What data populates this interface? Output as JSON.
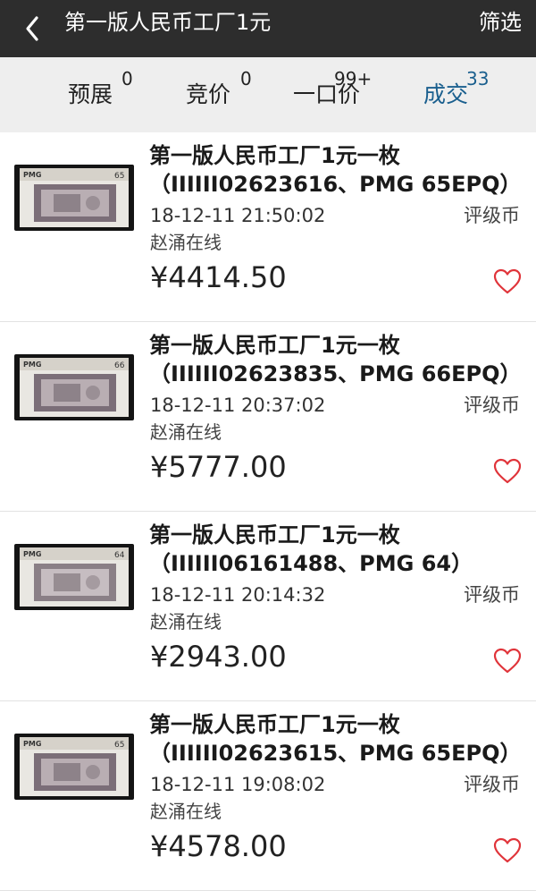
{
  "header": {
    "title": "第一版人民币工厂1元",
    "filter_label": "筛选"
  },
  "tabs": [
    {
      "label": "预展",
      "count": "0"
    },
    {
      "label": "竞价",
      "count": "0"
    },
    {
      "label": "一口价",
      "count": "99+"
    },
    {
      "label": "成交",
      "count": "33"
    }
  ],
  "active_tab": "成交",
  "items": [
    {
      "title": "第一版人民币工厂1元一枚（IIIIII02623616、PMG 65EPQ）",
      "time": "18-12-11 21:50:02",
      "category": "评级币",
      "seller": "赵涌在线",
      "price": "¥4414.50",
      "grade": "65",
      "grader": "PMG"
    },
    {
      "title": "第一版人民币工厂1元一枚（IIIIII02623835、PMG 66EPQ）",
      "time": "18-12-11 20:37:02",
      "category": "评级币",
      "seller": "赵涌在线",
      "price": "¥5777.00",
      "grade": "66",
      "grader": "PMG"
    },
    {
      "title": "第一版人民币工厂1元一枚（IIIIII06161488、PMG 64）",
      "time": "18-12-11 20:14:32",
      "category": "评级币",
      "seller": "赵涌在线",
      "price": "¥2943.00",
      "grade": "64",
      "grader": "PMG"
    },
    {
      "title": "第一版人民币工厂1元一枚（IIIIII02623615、PMG 65EPQ）",
      "time": "18-12-11 19:08:02",
      "category": "评级币",
      "seller": "赵涌在线",
      "price": "¥4578.00",
      "grade": "65",
      "grader": "PMG"
    }
  ],
  "colors": {
    "header_bg": "#2d2d2d",
    "tabs_bg": "#eeeeee",
    "active_tab": "#1a5f8e",
    "heart": "#e0343a"
  },
  "icons": {
    "back": "chevron-left-icon",
    "favorite": "heart-outline-icon"
  }
}
